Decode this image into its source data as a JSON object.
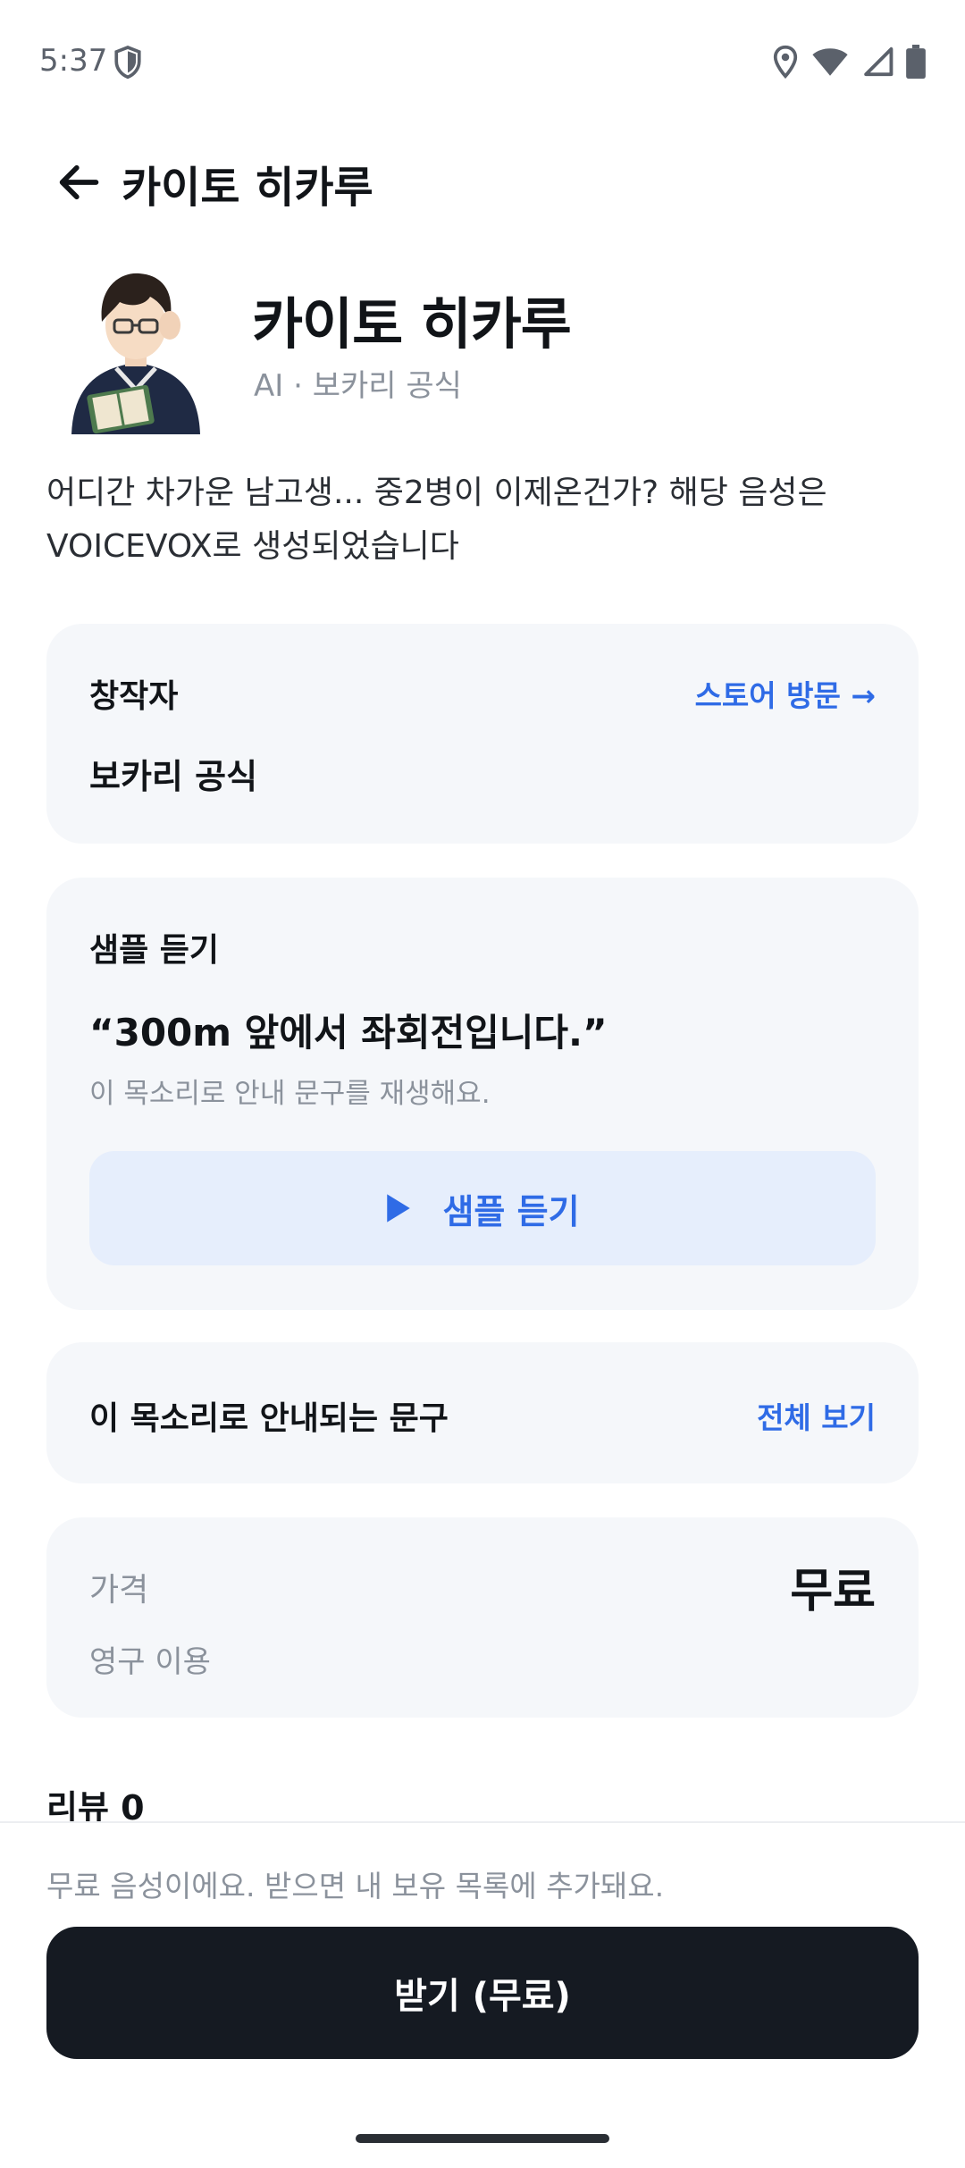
{
  "status_bar": {
    "time": "5:37",
    "icons": [
      "shield-icon",
      "location-icon",
      "wifi-icon",
      "signal-icon",
      "battery-icon"
    ]
  },
  "header": {
    "title": "카이토 히카루",
    "back_icon": "arrow-left-icon"
  },
  "profile": {
    "name": "카이토 히카루",
    "subtitle": "AI · 보카리 공식",
    "description": "어디간 차가운 남고생...  중2병이 이제온건가?  해당 음성은 VOICEVOX로 생성되었습니다"
  },
  "creator_card": {
    "label": "창작자",
    "store_link": "스토어 방문 →",
    "creator_name": "보카리 공식"
  },
  "sample_card": {
    "label": "샘플 듣기",
    "quote": "“300m 앞에서 좌회전입니다.”",
    "hint": "이 목소리로 안내 문구를 재생해요.",
    "play_button": "샘플 듣기",
    "play_icon": "play-icon"
  },
  "phrases_card": {
    "label": "이 목소리로 안내되는 문구",
    "link": "전체 보기"
  },
  "price_card": {
    "label": "가격",
    "value": "무료",
    "term": "영구 이용"
  },
  "reviews": {
    "title": "리뷰 0"
  },
  "bottom": {
    "note": "무료 음성이에요. 받으면 내 보유 목록에 추가돼요.",
    "button": "받기 (무료)"
  },
  "colors": {
    "accent": "#2f6be6",
    "card_bg": "#f5f7fa",
    "play_bg": "#e6eefc",
    "primary_button": "#151a22",
    "muted_text": "#8b929c"
  }
}
